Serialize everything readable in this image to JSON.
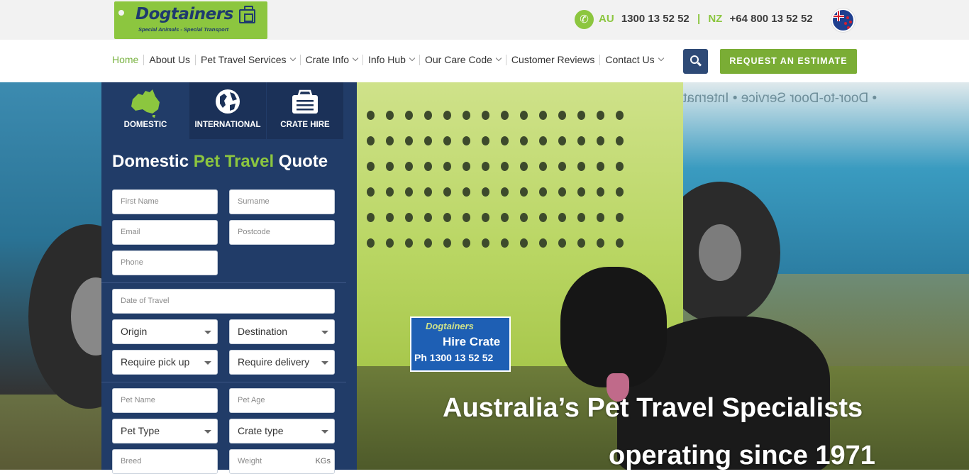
{
  "header": {
    "logo_name": "Dogtainers",
    "logo_tagline": "Special Animals - Special Transport",
    "phone_au_code": "AU",
    "phone_au_number": "1300 13 52 52",
    "phone_separator": "|",
    "phone_nz_code": "NZ",
    "phone_nz_number": "+64 800 13 52 52",
    "icons": {
      "phone": "phone-icon",
      "flag": "nz-flag-icon"
    }
  },
  "nav": {
    "items": [
      {
        "label": "Home",
        "active": true,
        "dropdown": false
      },
      {
        "label": "About Us",
        "active": false,
        "dropdown": false
      },
      {
        "label": "Pet Travel Services",
        "active": false,
        "dropdown": true
      },
      {
        "label": "Crate Info",
        "active": false,
        "dropdown": true
      },
      {
        "label": "Info Hub",
        "active": false,
        "dropdown": true
      },
      {
        "label": "Our Care Code",
        "active": false,
        "dropdown": true
      },
      {
        "label": "Customer Reviews",
        "active": false,
        "dropdown": false
      },
      {
        "label": "Contact Us",
        "active": false,
        "dropdown": true
      }
    ],
    "estimate_label": "REQUEST AN ESTIMATE",
    "colors": {
      "accent_green": "#7aad35",
      "navy": "#213c68"
    }
  },
  "quote": {
    "tabs": [
      {
        "label": "DOMESTIC",
        "icon": "australia-map-icon",
        "active": true
      },
      {
        "label": "INTERNATIONAL",
        "icon": "globe-icon",
        "active": false
      },
      {
        "label": "CRATE HIRE",
        "icon": "crate-icon",
        "active": false
      }
    ],
    "title_part1": "Domestic",
    "title_part2": "Pet Travel",
    "title_part3": "Quote",
    "placeholders": {
      "first_name": "First Name",
      "surname": "Surname",
      "email": "Email",
      "postcode": "Postcode",
      "phone": "Phone",
      "date_of_travel": "Date of Travel",
      "pet_name": "Pet Name",
      "pet_age": "Pet Age",
      "breed": "Breed",
      "weight": "Weight"
    },
    "weight_unit": "KGs",
    "selects": {
      "origin": "Origin",
      "destination": "Destination",
      "pickup": "Require pick up",
      "delivery": "Require delivery",
      "pet_type": "Pet Type",
      "crate_type": "Crate type"
    }
  },
  "hero": {
    "line1": "Australia’s Pet Travel Specialists",
    "line2": "operating since 1971",
    "van_text": "• Door-to-Door Service •   International &",
    "sticker_brand": "Dogtainers",
    "sticker_main": "Hire Crate",
    "sticker_phone": "Ph 1300 13 52 52"
  }
}
